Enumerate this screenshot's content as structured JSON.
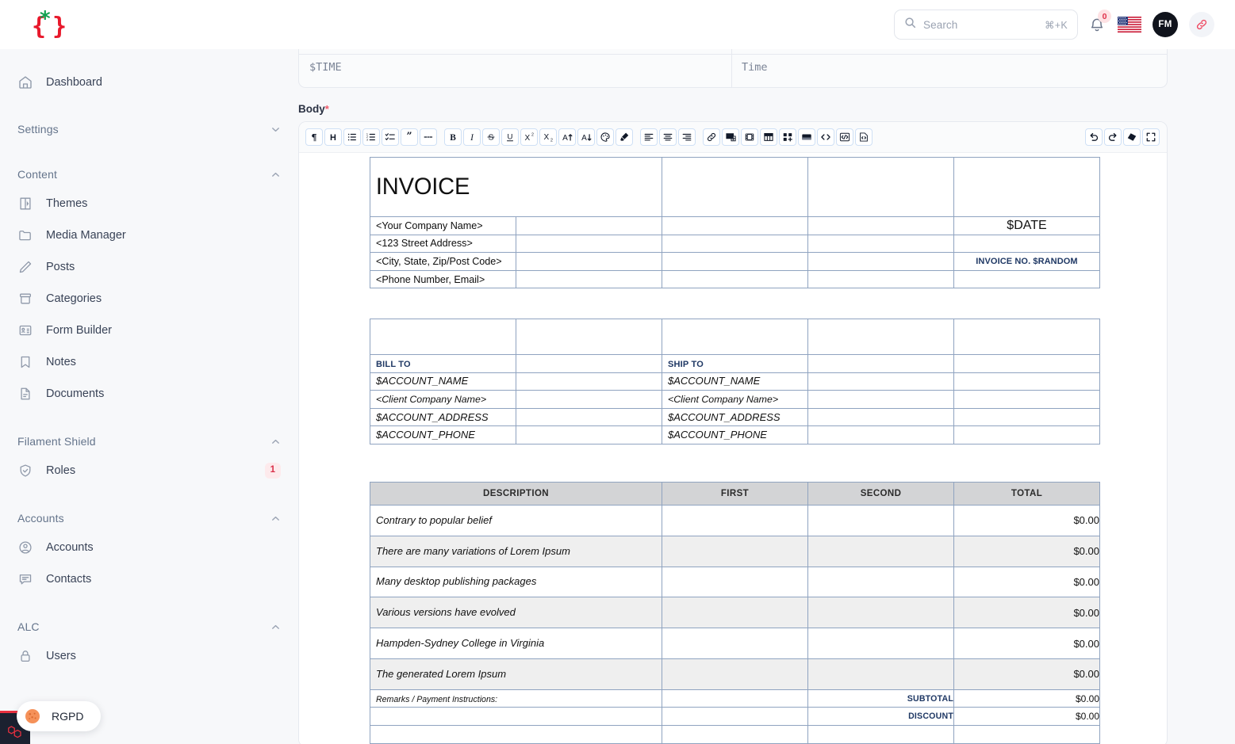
{
  "header": {
    "logo_icon": "curly-braces-asterisk-logo",
    "search": {
      "placeholder": "Search",
      "shortcut": "⌘+K",
      "icon": "search-icon"
    },
    "notifications": {
      "icon": "bell-icon",
      "count": "0"
    },
    "locale_flag": "us-flag-icon",
    "avatar_initials": "FM",
    "link_button_icon": "link-icon"
  },
  "sidebar": {
    "top_items": [
      {
        "label": "Dashboard",
        "icon": "home-icon"
      }
    ],
    "groups": [
      {
        "label": "Settings",
        "icon": "chevron-down-icon",
        "expanded": false,
        "items": []
      },
      {
        "label": "Content",
        "icon": "chevron-up-icon",
        "expanded": true,
        "items": [
          {
            "label": "Themes",
            "icon": "theme-page-icon"
          },
          {
            "label": "Media Manager",
            "icon": "folder-icon"
          },
          {
            "label": "Posts",
            "icon": "pencil-icon"
          },
          {
            "label": "Categories",
            "icon": "archive-box-icon"
          },
          {
            "label": "Form Builder",
            "icon": "id-card-icon"
          },
          {
            "label": "Notes",
            "icon": "bookmark-icon"
          },
          {
            "label": "Documents",
            "icon": "document-icon"
          }
        ]
      },
      {
        "label": "Filament Shield",
        "icon": "chevron-up-icon",
        "expanded": true,
        "items": [
          {
            "label": "Roles",
            "icon": "shield-check-icon",
            "badge": "1"
          }
        ]
      },
      {
        "label": "Accounts",
        "icon": "chevron-up-icon",
        "expanded": true,
        "items": [
          {
            "label": "Accounts",
            "icon": "user-circle-icon"
          },
          {
            "label": "Contacts",
            "icon": "chat-bubble-icon"
          }
        ]
      },
      {
        "label": "ALC",
        "icon": "chevron-up-icon",
        "expanded": true,
        "items": [
          {
            "label": "Users",
            "icon": "lock-icon"
          }
        ]
      }
    ],
    "rgpd_button": {
      "label": "RGPD",
      "icon": "cookie-icon"
    },
    "laravel_badge_icon": "laravel-logo-icon"
  },
  "form": {
    "time_row": {
      "value": "$TIME",
      "label": "Time"
    },
    "body_field": {
      "label": "Body",
      "required_marker": "*"
    }
  },
  "toolbar": {
    "left_buttons": [
      {
        "name": "paragraph-button",
        "glyph": "¶"
      },
      {
        "name": "heading-button",
        "glyph": "H"
      },
      {
        "name": "bullet-list-button",
        "glyph": "bullet-list-icon"
      },
      {
        "name": "ordered-list-button",
        "glyph": "ordered-list-icon"
      },
      {
        "name": "checklist-button",
        "glyph": "checklist-icon"
      },
      {
        "name": "blockquote-button",
        "glyph": "”"
      },
      {
        "name": "horizontal-rule-button",
        "glyph": "horizontal-rule-icon"
      },
      {
        "name": "bold-button",
        "glyph": "B"
      },
      {
        "name": "italic-button",
        "glyph": "I"
      },
      {
        "name": "strikethrough-button",
        "glyph": "S"
      },
      {
        "name": "underline-button",
        "glyph": "U"
      },
      {
        "name": "superscript-button",
        "glyph": "X²"
      },
      {
        "name": "subscript-button",
        "glyph": "X₂"
      },
      {
        "name": "increase-font-size-button",
        "glyph": "A↑"
      },
      {
        "name": "decrease-font-size-button",
        "glyph": "A↓"
      },
      {
        "name": "text-color-button",
        "glyph": "palette-icon"
      },
      {
        "name": "highlight-button",
        "glyph": "marker-icon"
      },
      {
        "name": "align-left-button",
        "glyph": "align-left-icon"
      },
      {
        "name": "align-center-button",
        "glyph": "align-center-icon"
      },
      {
        "name": "align-right-button",
        "glyph": "align-right-icon"
      },
      {
        "name": "link-button",
        "glyph": "link-icon"
      },
      {
        "name": "insert-image-button",
        "glyph": "image-plus-icon"
      },
      {
        "name": "insert-video-button",
        "glyph": "film-icon"
      },
      {
        "name": "insert-table-button",
        "glyph": "table-icon"
      },
      {
        "name": "insert-grid-button",
        "glyph": "grid-plus-icon"
      },
      {
        "name": "insert-hero-button",
        "glyph": "hero-block-icon"
      },
      {
        "name": "code-button",
        "glyph": "code-icon"
      },
      {
        "name": "code-block-button",
        "glyph": "code-block-icon"
      },
      {
        "name": "source-view-button",
        "glyph": "source-file-icon"
      }
    ],
    "right_buttons": [
      {
        "name": "undo-button",
        "glyph": "undo-icon"
      },
      {
        "name": "redo-button",
        "glyph": "redo-icon"
      },
      {
        "name": "clear-format-button",
        "glyph": "eraser-icon"
      },
      {
        "name": "fullscreen-button",
        "glyph": "fullscreen-icon"
      }
    ]
  },
  "invoice": {
    "title": "INVOICE",
    "company_lines": [
      "<Your Company Name>",
      "<123 Street Address>",
      "<City, State, Zip/Post Code>",
      "<Phone Number, Email>"
    ],
    "date_token": "$DATE",
    "invoice_no_token": "INVOICE NO. $RANDOM",
    "bill_to": {
      "heading": "BILL TO",
      "lines": [
        "$ACCOUNT_NAME",
        "<Client Company Name>",
        "$ACCOUNT_ADDRESS",
        "$ACCOUNT_PHONE"
      ]
    },
    "ship_to": {
      "heading": "SHIP TO",
      "lines": [
        "$ACCOUNT_NAME",
        "<Client Company Name>",
        "$ACCOUNT_ADDRESS",
        "$ACCOUNT_PHONE"
      ]
    },
    "items_header": [
      "DESCRIPTION",
      "FIRST",
      "SECOND",
      "TOTAL"
    ],
    "items": [
      {
        "description": "Contrary to popular belief",
        "first": "",
        "second": "",
        "total": "$0.00"
      },
      {
        "description": "There are many variations of Lorem Ipsum",
        "first": "",
        "second": "",
        "total": "$0.00"
      },
      {
        "description": "Many desktop publishing packages",
        "first": "",
        "second": "",
        "total": "$0.00"
      },
      {
        "description": "Various versions have evolved",
        "first": "",
        "second": "",
        "total": "$0.00"
      },
      {
        "description": "Hampden-Sydney College in Virginia",
        "first": "",
        "second": "",
        "total": "$0.00"
      },
      {
        "description": "The generated Lorem Ipsum",
        "first": "",
        "second": "",
        "total": "$0.00"
      }
    ],
    "remarks_label": "Remarks / Payment Instructions:",
    "totals": [
      {
        "label": "SUBTOTAL",
        "value": "$0.00"
      },
      {
        "label": "DISCOUNT",
        "value": "$0.00"
      }
    ]
  },
  "colors": {
    "accent_red": "#e8303f",
    "accent_green": "#12a150",
    "navy": "#1f3864",
    "table_border": "#8fa3c0",
    "items_header_bg": "#d3d4d6",
    "page_bg": "#f7f8fa"
  }
}
